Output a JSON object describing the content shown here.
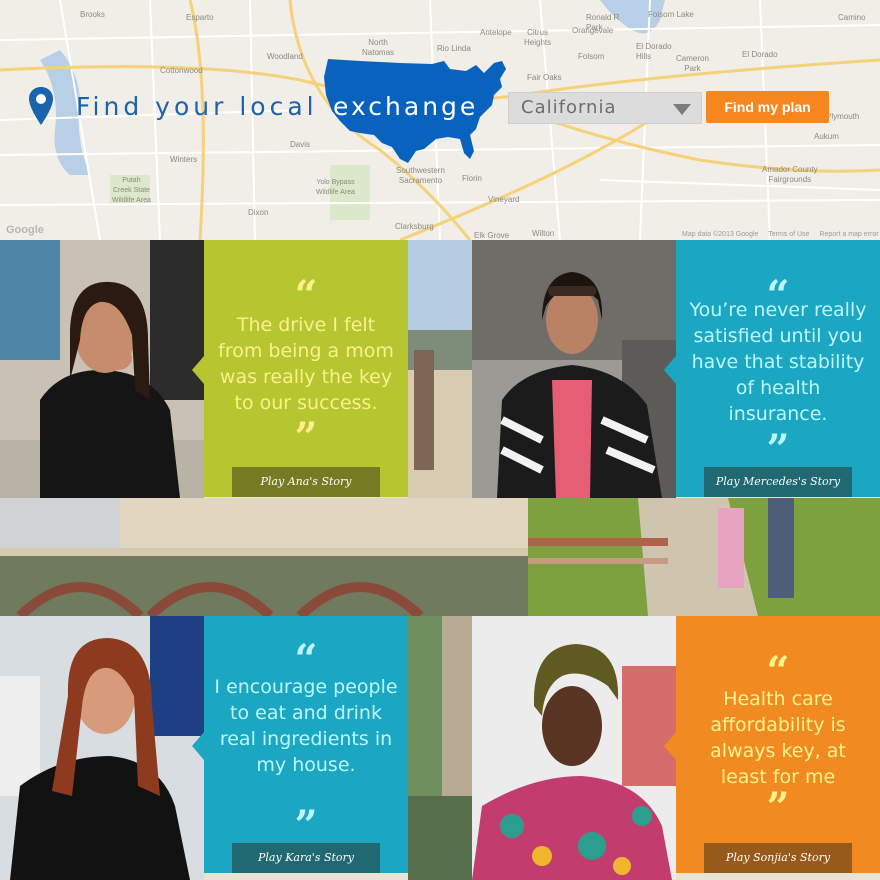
{
  "map": {
    "labels": [
      {
        "id": "brooks",
        "text": "Brooks"
      },
      {
        "id": "esparto",
        "text": "Esparto"
      },
      {
        "id": "cottonwood",
        "text": "Cottonwood"
      },
      {
        "id": "woodland",
        "text": "Woodland"
      },
      {
        "id": "north_natomas",
        "text": "North\nNatomas"
      },
      {
        "id": "rio_linda",
        "text": "Rio Linda"
      },
      {
        "id": "antelope",
        "text": "Antelope"
      },
      {
        "id": "citrus_heights",
        "text": "Citrus\nHeights"
      },
      {
        "id": "orangevale",
        "text": "Orangevale"
      },
      {
        "id": "ronald_reagan",
        "text": "Ronald R\nPark"
      },
      {
        "id": "folsom_lake",
        "text": "Folsom Lake"
      },
      {
        "id": "el_dorado_hills",
        "text": "El Dorado\nHills"
      },
      {
        "id": "cameron_park",
        "text": "Cameron\nPark"
      },
      {
        "id": "camino",
        "text": "Camino"
      },
      {
        "id": "el_dorado",
        "text": "El Dorado"
      },
      {
        "id": "folsom",
        "text": "Folsom"
      },
      {
        "id": "fair_oaks",
        "text": "Fair Oaks"
      },
      {
        "id": "davis",
        "text": "Davis"
      },
      {
        "id": "winters",
        "text": "Winters"
      },
      {
        "id": "putah",
        "text": "Putah\nCreek State\nWildlife Area"
      },
      {
        "id": "yolo",
        "text": "Yolo Bypass\nWildlife Area"
      },
      {
        "id": "southwestern",
        "text": "Southwestern\nSacramento"
      },
      {
        "id": "florin",
        "text": "Florin"
      },
      {
        "id": "vineyard",
        "text": "Vineyard"
      },
      {
        "id": "dixon",
        "text": "Dixon"
      },
      {
        "id": "clarksburg",
        "text": "Clarksburg"
      },
      {
        "id": "elk_grove",
        "text": "Elk Grove"
      },
      {
        "id": "wilton",
        "text": "Wilton"
      },
      {
        "id": "amador",
        "text": "Amador County\nFairgrounds"
      },
      {
        "id": "aukum",
        "text": "Aukum"
      },
      {
        "id": "plymouth",
        "text": "Plymouth"
      }
    ],
    "google_logo": "Google",
    "attribution": [
      "Map data ©2013 Google",
      "Terms of Use",
      "Report a map error"
    ]
  },
  "header": {
    "headline_left": "Find your local",
    "headline_right": "exchange",
    "select_value": "California",
    "cta_label": "Find my plan"
  },
  "colors": {
    "accent_blue": "#1a63ad",
    "cta_orange": "#f7861e",
    "lime": "#b6c631",
    "teal": "#1ba6c2",
    "orange": "#f28a22"
  },
  "stories": [
    {
      "id": "ana",
      "quote_open": "“",
      "text": "The drive I felt from being a mom was really the key to our success.",
      "quote_close": "”",
      "button": "Play Ana's Story"
    },
    {
      "id": "mercedes",
      "quote_open": "“",
      "text": "You’re never really satisfied until you have that stability of health insurance.",
      "quote_close": "”",
      "button": "Play Mercedes's Story"
    },
    {
      "id": "kara",
      "quote_open": "“",
      "text": "I encourage people to eat and drink real ingredients in my house.",
      "quote_close": "”",
      "button": "Play Kara's Story"
    },
    {
      "id": "sonjia",
      "quote_open": "“",
      "text": "Health care affordability is always key, at least for me",
      "quote_close": "”",
      "button": "Play Sonjia's Story"
    }
  ]
}
